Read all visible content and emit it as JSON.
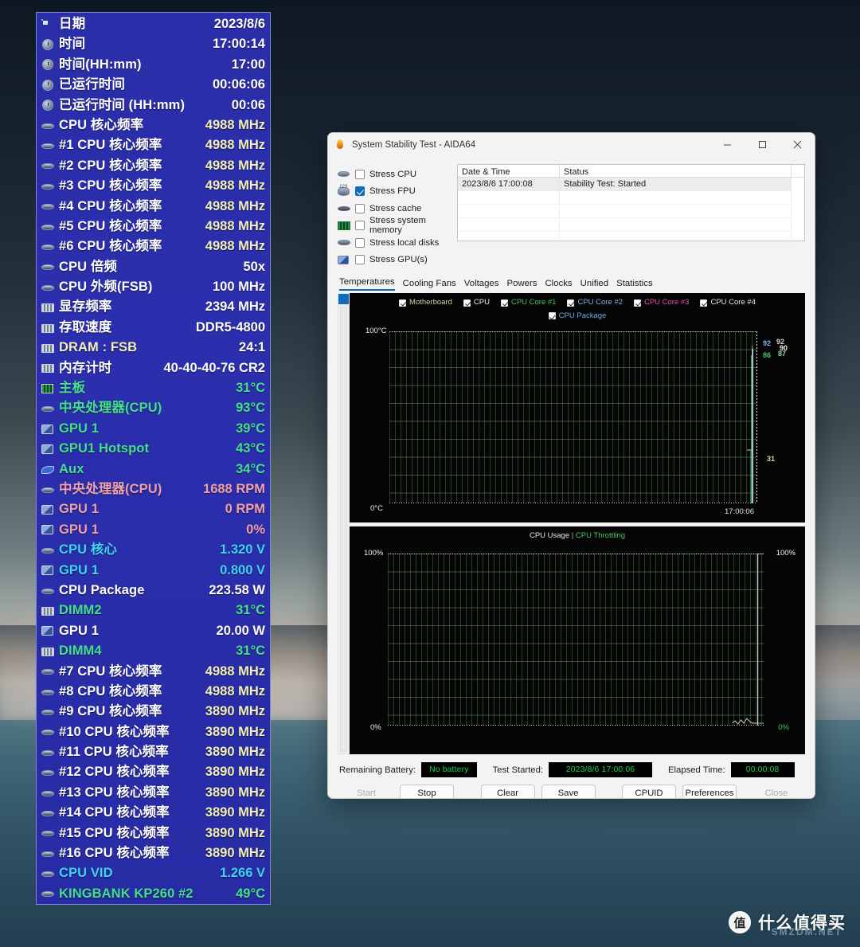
{
  "desktop": {
    "watermark": {
      "logo_glyph": "值",
      "text": "什么值得买",
      "sub": "SMZDM.NET"
    }
  },
  "sensor_panel": {
    "rows": [
      {
        "icon": "calendar-icon",
        "label": "日期",
        "value": "2023/8/6",
        "label_color": "#ffffff",
        "value_color": "#ffffff"
      },
      {
        "icon": "clock-icon",
        "label": "时间",
        "value": "17:00:14",
        "label_color": "#ffffff",
        "value_color": "#ffffff"
      },
      {
        "icon": "clock-icon",
        "label": "时间(HH:mm)",
        "value": "17:00",
        "label_color": "#ffffff",
        "value_color": "#ffffff"
      },
      {
        "icon": "clock-icon",
        "label": "已运行时间",
        "value": "00:06:06",
        "label_color": "#ffffff",
        "value_color": "#ffffff"
      },
      {
        "icon": "clock-icon",
        "label": "已运行时间 (HH:mm)",
        "value": "00:06",
        "label_color": "#ffffff",
        "value_color": "#ffffff"
      },
      {
        "icon": "cpu-icon",
        "label": "CPU 核心频率",
        "value": "4988 MHz",
        "label_color": "#ffffff",
        "value_color": "#f2f0b8"
      },
      {
        "icon": "cpu-icon",
        "label": "#1 CPU 核心频率",
        "value": "4988 MHz",
        "label_color": "#ffffff",
        "value_color": "#f2f0b8"
      },
      {
        "icon": "cpu-icon",
        "label": "#2 CPU 核心频率",
        "value": "4988 MHz",
        "label_color": "#ffffff",
        "value_color": "#f2f0b8"
      },
      {
        "icon": "cpu-icon",
        "label": "#3 CPU 核心频率",
        "value": "4988 MHz",
        "label_color": "#ffffff",
        "value_color": "#f2f0b8"
      },
      {
        "icon": "cpu-icon",
        "label": "#4 CPU 核心频率",
        "value": "4988 MHz",
        "label_color": "#ffffff",
        "value_color": "#f2f0b8"
      },
      {
        "icon": "cpu-icon",
        "label": "#5 CPU 核心频率",
        "value": "4988 MHz",
        "label_color": "#ffffff",
        "value_color": "#f2f0b8"
      },
      {
        "icon": "cpu-icon",
        "label": "#6 CPU 核心频率",
        "value": "4988 MHz",
        "label_color": "#ffffff",
        "value_color": "#f2f0b8"
      },
      {
        "icon": "cpu-icon",
        "label": "CPU 倍频",
        "value": "50x",
        "label_color": "#ffffff",
        "value_color": "#ffffff"
      },
      {
        "icon": "cpu-icon",
        "label": "CPU 外频(FSB)",
        "value": "100 MHz",
        "label_color": "#ffffff",
        "value_color": "#ffffff"
      },
      {
        "icon": "dimm-icon",
        "label": "显存频率",
        "value": "2394 MHz",
        "label_color": "#ffffff",
        "value_color": "#ffffff"
      },
      {
        "icon": "dimm-icon",
        "label": "存取速度",
        "value": "DDR5-4800",
        "label_color": "#ffffff",
        "value_color": "#ffffff"
      },
      {
        "icon": "dimm-icon",
        "label": "DRAM : FSB",
        "value": "24:1",
        "label_color": "#f2f0b8",
        "value_color": "#ffffff"
      },
      {
        "icon": "dimm-icon",
        "label": "内存计时",
        "value": "40-40-40-76 CR2",
        "label_color": "#ffffff",
        "value_color": "#ffffff"
      },
      {
        "icon": "motherboard-icon",
        "label": "主板",
        "value": "31°C",
        "label_color": "#44e08a",
        "value_color": "#44e08a"
      },
      {
        "icon": "cpu-icon",
        "label": "中央处理器(CPU)",
        "value": "93°C",
        "label_color": "#44e08a",
        "value_color": "#44e08a"
      },
      {
        "icon": "gpu-icon",
        "label": "GPU 1",
        "value": "39°C",
        "label_color": "#44e08a",
        "value_color": "#44e08a"
      },
      {
        "icon": "gpu-icon",
        "label": "GPU1 Hotspot",
        "value": "43°C",
        "label_color": "#44e08a",
        "value_color": "#44e08a"
      },
      {
        "icon": "aux-icon",
        "label": "Aux",
        "value": "34°C",
        "label_color": "#44e08a",
        "value_color": "#44e08a"
      },
      {
        "icon": "cpu-icon",
        "label": "中央处理器(CPU)",
        "value": "1688 RPM",
        "label_color": "#f0a0a8",
        "value_color": "#f0a0a8"
      },
      {
        "icon": "gpu-icon",
        "label": "GPU 1",
        "value": "0 RPM",
        "label_color": "#f0a0a8",
        "value_color": "#f0a0a8"
      },
      {
        "icon": "gpu-icon",
        "label": "GPU 1",
        "value": "0%",
        "label_color": "#f0a0a8",
        "value_color": "#f0a0a8"
      },
      {
        "icon": "cpu-icon",
        "label": "CPU 核心",
        "value": "1.320 V",
        "label_color": "#3fd4f5",
        "value_color": "#3fd4f5"
      },
      {
        "icon": "gpu-icon",
        "label": "GPU 1",
        "value": "0.800 V",
        "label_color": "#3fd4f5",
        "value_color": "#3fd4f5"
      },
      {
        "icon": "cpu-icon",
        "label": "CPU Package",
        "value": "223.58 W",
        "label_color": "#ffffff",
        "value_color": "#ffffff"
      },
      {
        "icon": "dimm-icon",
        "label": "DIMM2",
        "value": "31°C",
        "label_color": "#44e08a",
        "value_color": "#44e08a"
      },
      {
        "icon": "gpu-icon",
        "label": "GPU 1",
        "value": "20.00 W",
        "label_color": "#ffffff",
        "value_color": "#ffffff"
      },
      {
        "icon": "dimm-icon",
        "label": "DIMM4",
        "value": "31°C",
        "label_color": "#44e08a",
        "value_color": "#44e08a"
      },
      {
        "icon": "cpu-icon",
        "label": "#7 CPU 核心频率",
        "value": "4988 MHz",
        "label_color": "#ffffff",
        "value_color": "#f2f0b8"
      },
      {
        "icon": "cpu-icon",
        "label": "#8 CPU 核心频率",
        "value": "4988 MHz",
        "label_color": "#ffffff",
        "value_color": "#f2f0b8"
      },
      {
        "icon": "cpu-icon",
        "label": "#9 CPU 核心频率",
        "value": "3890 MHz",
        "label_color": "#ffffff",
        "value_color": "#f2f0b8"
      },
      {
        "icon": "cpu-icon",
        "label": "#10 CPU 核心频率",
        "value": "3890 MHz",
        "label_color": "#ffffff",
        "value_color": "#f2f0b8"
      },
      {
        "icon": "cpu-icon",
        "label": "#11 CPU 核心频率",
        "value": "3890 MHz",
        "label_color": "#ffffff",
        "value_color": "#f2f0b8"
      },
      {
        "icon": "cpu-icon",
        "label": "#12 CPU 核心频率",
        "value": "3890 MHz",
        "label_color": "#ffffff",
        "value_color": "#f2f0b8"
      },
      {
        "icon": "cpu-icon",
        "label": "#13 CPU 核心频率",
        "value": "3890 MHz",
        "label_color": "#ffffff",
        "value_color": "#f2f0b8"
      },
      {
        "icon": "cpu-icon",
        "label": "#14 CPU 核心频率",
        "value": "3890 MHz",
        "label_color": "#ffffff",
        "value_color": "#f2f0b8"
      },
      {
        "icon": "cpu-icon",
        "label": "#15 CPU 核心频率",
        "value": "3890 MHz",
        "label_color": "#ffffff",
        "value_color": "#f2f0b8"
      },
      {
        "icon": "cpu-icon",
        "label": "#16 CPU 核心频率",
        "value": "3890 MHz",
        "label_color": "#ffffff",
        "value_color": "#f2f0b8"
      },
      {
        "icon": "cpu-icon",
        "label": "CPU VID",
        "value": "1.266 V",
        "label_color": "#3fd4f5",
        "value_color": "#3fd4f5"
      },
      {
        "icon": "cpu-icon",
        "label": "KINGBANK KP260 #2",
        "value": "49°C",
        "label_color": "#44e08a",
        "value_color": "#44e08a"
      }
    ]
  },
  "window": {
    "title": "System Stability Test - AIDA64",
    "icon": "aida64-flame-icon",
    "minimize": "−",
    "maximize": "□",
    "close": "✕",
    "stress_options": [
      {
        "label": "Stress CPU",
        "checked": false,
        "icon": "cpu-icon"
      },
      {
        "label": "Stress FPU",
        "checked": true,
        "icon": "fpu-icon"
      },
      {
        "label": "Stress cache",
        "checked": false,
        "icon": "cache-icon"
      },
      {
        "label": "Stress system memory",
        "checked": false,
        "icon": "memory-icon"
      },
      {
        "label": "Stress local disks",
        "checked": false,
        "icon": "disk-icon"
      },
      {
        "label": "Stress GPU(s)",
        "checked": false,
        "icon": "gpu-icon"
      }
    ],
    "log": {
      "headers": [
        "Date & Time",
        "Status"
      ],
      "rows": [
        {
          "datetime": "2023/8/6 17:00:08",
          "status": "Stability Test: Started"
        }
      ]
    },
    "tabs": [
      {
        "label": "Temperatures",
        "active": true
      },
      {
        "label": "Cooling Fans",
        "active": false
      },
      {
        "label": "Voltages",
        "active": false
      },
      {
        "label": "Powers",
        "active": false
      },
      {
        "label": "Clocks",
        "active": false
      },
      {
        "label": "Unified",
        "active": false
      },
      {
        "label": "Statistics",
        "active": false
      }
    ],
    "status": {
      "battery_label": "Remaining Battery:",
      "battery_value": "No battery",
      "started_label": "Test Started:",
      "started_value": "2023/8/6 17:00:06",
      "elapsed_label": "Elapsed Time:",
      "elapsed_value": "00:00:08"
    },
    "buttons": [
      {
        "label": "Start",
        "disabled": true
      },
      {
        "label": "Stop",
        "disabled": false
      },
      {
        "label": "Clear",
        "disabled": false
      },
      {
        "label": "Save",
        "disabled": false
      },
      {
        "label": "CPUID",
        "disabled": false
      },
      {
        "label": "Preferences",
        "disabled": false
      },
      {
        "label": "Close",
        "disabled": true
      }
    ]
  },
  "chart_data": [
    {
      "type": "line",
      "title": "Temperatures",
      "ylabel": "",
      "y_top_label": "100°C",
      "y_bottom_label": "0°C",
      "ylim": [
        0,
        100
      ],
      "grid": true,
      "time_label": "17:00:06",
      "legend_position": "top",
      "legend": [
        {
          "name": "Motherboard",
          "color": "#d8d0a0",
          "checked": true
        },
        {
          "name": "CPU",
          "color": "#f0f0f0",
          "checked": true
        },
        {
          "name": "CPU Core #1",
          "color": "#49c46a",
          "checked": true
        },
        {
          "name": "CPU Core #2",
          "color": "#7fb3e8",
          "checked": true
        },
        {
          "name": "CPU Core #3",
          "color": "#e153b6",
          "checked": true
        },
        {
          "name": "CPU Core #4",
          "color": "#e8e8e8",
          "checked": true
        },
        {
          "name": "CPU Package",
          "color": "#6fa9e0",
          "checked": true
        }
      ],
      "current_values": [
        {
          "name": "CPU Package",
          "value": "92",
          "color": "#7fb3e8"
        },
        {
          "name": "CPU Core #2",
          "value": "92",
          "color": "#cfd8e8"
        },
        {
          "name": "CPU",
          "value": "90",
          "color": "#f0f0f0"
        },
        {
          "name": "CPU Core #1",
          "value": "86",
          "color": "#49c46a"
        },
        {
          "name": "CPU Core #4",
          "value": "87",
          "color": "#8fd8a6"
        },
        {
          "name": "Motherboard",
          "value": "31",
          "color": "#d8d0a0"
        }
      ]
    },
    {
      "type": "line",
      "title": "CPU Usage | CPU Throttling",
      "legend": [
        {
          "name": "CPU Usage",
          "color": "#e8e8e8"
        },
        {
          "name": "CPU Throttling",
          "color": "#49c46a"
        }
      ],
      "y_top_label": "100%",
      "y_bottom_label": "0%",
      "y_top_right_label": "100%",
      "y_bottom_right_label": "0%",
      "ylim": [
        0,
        100
      ],
      "grid": true,
      "current_values": [
        {
          "name": "CPU Usage",
          "value": "100"
        },
        {
          "name": "CPU Throttling",
          "value": "0"
        }
      ]
    }
  ]
}
